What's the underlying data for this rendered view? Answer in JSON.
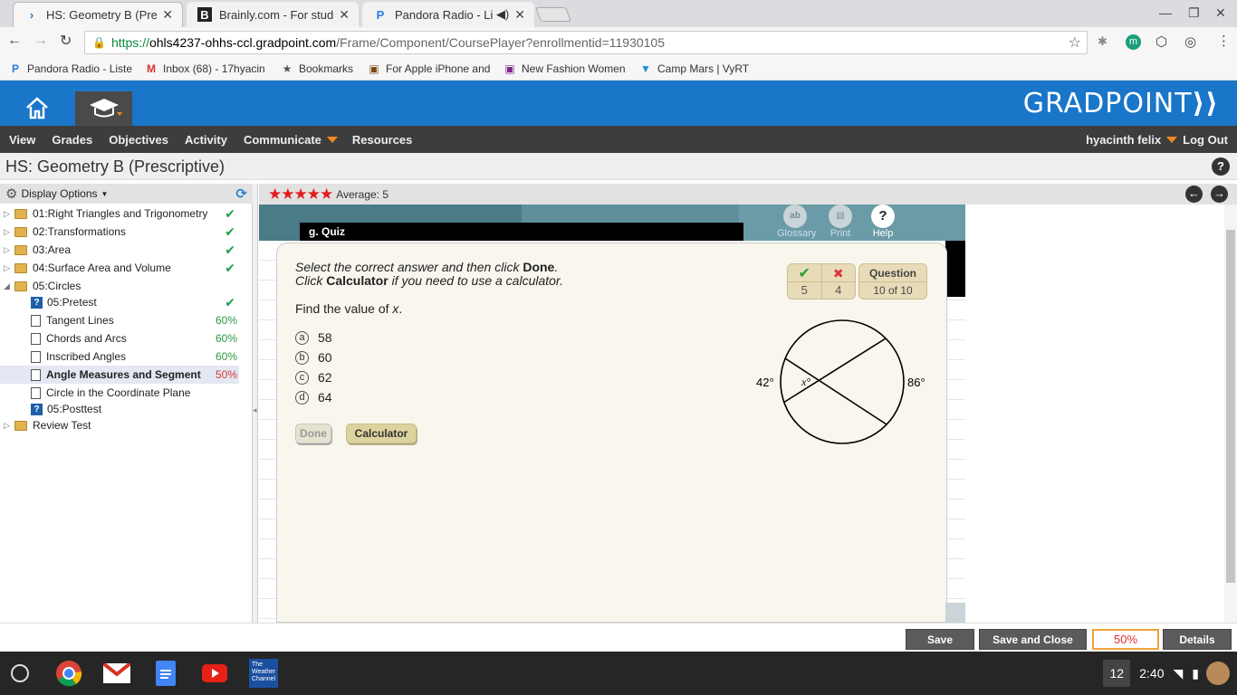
{
  "browser": {
    "tabs": [
      {
        "title": "HS: Geometry B (Prescrip",
        "active": true
      },
      {
        "title": "Brainly.com - For studen",
        "active": false
      },
      {
        "title": "Pandora Radio - Liste",
        "active": false
      }
    ],
    "url": {
      "https": "https://",
      "host": "ohls4237-ohhs-ccl.gradpoint.com",
      "path": "/Frame/Component/CoursePlayer?enrollmentid=11930105"
    },
    "bookmarks": [
      "Pandora Radio - Liste",
      "Inbox (68) - 17hyacin",
      "Bookmarks",
      "For Apple iPhone and",
      "New Fashion Women",
      "Camp Mars | VyRT"
    ]
  },
  "app": {
    "logo": "GRADPOINT",
    "menu": [
      "View",
      "Grades",
      "Objectives",
      "Activity",
      "Communicate",
      "Resources"
    ],
    "user": "hyacinth felix",
    "logout": "Log Out",
    "page_title": "HS: Geometry B (Prescriptive)"
  },
  "sidebar": {
    "display_options": "Display Options",
    "items": [
      {
        "label": "01:Right Triangles and Trigonometry",
        "status": "check"
      },
      {
        "label": "02:Transformations",
        "status": "check"
      },
      {
        "label": "03:Area",
        "status": "check"
      },
      {
        "label": "04:Surface Area and Volume",
        "status": "check"
      },
      {
        "label": "05:Circles",
        "status": ""
      },
      {
        "label": "05:Pretest",
        "status": "check"
      },
      {
        "label": "Tangent Lines",
        "status": "60%"
      },
      {
        "label": "Chords and Arcs",
        "status": "60%"
      },
      {
        "label": "Inscribed Angles",
        "status": "60%"
      },
      {
        "label": "Angle Measures and Segment",
        "status": "50%"
      },
      {
        "label": "Circle in the Coordinate Plane",
        "status": ""
      },
      {
        "label": "05:Posttest",
        "status": ""
      },
      {
        "label": "Review Test",
        "status": ""
      }
    ]
  },
  "rating": {
    "stars": 5,
    "average": "Average: 5"
  },
  "quiz": {
    "label": "g. Quiz",
    "tools": [
      "Glossary",
      "Print",
      "Help"
    ],
    "instruction1_a": "Select the correct answer and then click ",
    "instruction1_b": "Done",
    "instruction1_c": ".",
    "instruction2_a": "Click ",
    "instruction2_b": "Calculator",
    "instruction2_c": " if you need to use a calculator.",
    "prompt": "Find the value of ",
    "prompt_var": "x",
    "prompt_end": ".",
    "options": [
      {
        "letter": "a",
        "value": "58"
      },
      {
        "letter": "b",
        "value": "60"
      },
      {
        "letter": "c",
        "value": "62"
      },
      {
        "letter": "d",
        "value": "64"
      }
    ],
    "done_label": "Done",
    "calculator_label": "Calculator",
    "correct": "5",
    "incorrect": "4",
    "question_label": "Question",
    "question_progress": "10 of 10",
    "figure": {
      "left_arc": "42°",
      "right_arc": "86°",
      "angle_label": "x°"
    }
  },
  "bottom": {
    "save": "Save",
    "save_close": "Save and Close",
    "percent": "50%",
    "details": "Details"
  },
  "shelf": {
    "badge": "12",
    "time": "2:40",
    "weather_label": "The Weather Channel"
  }
}
